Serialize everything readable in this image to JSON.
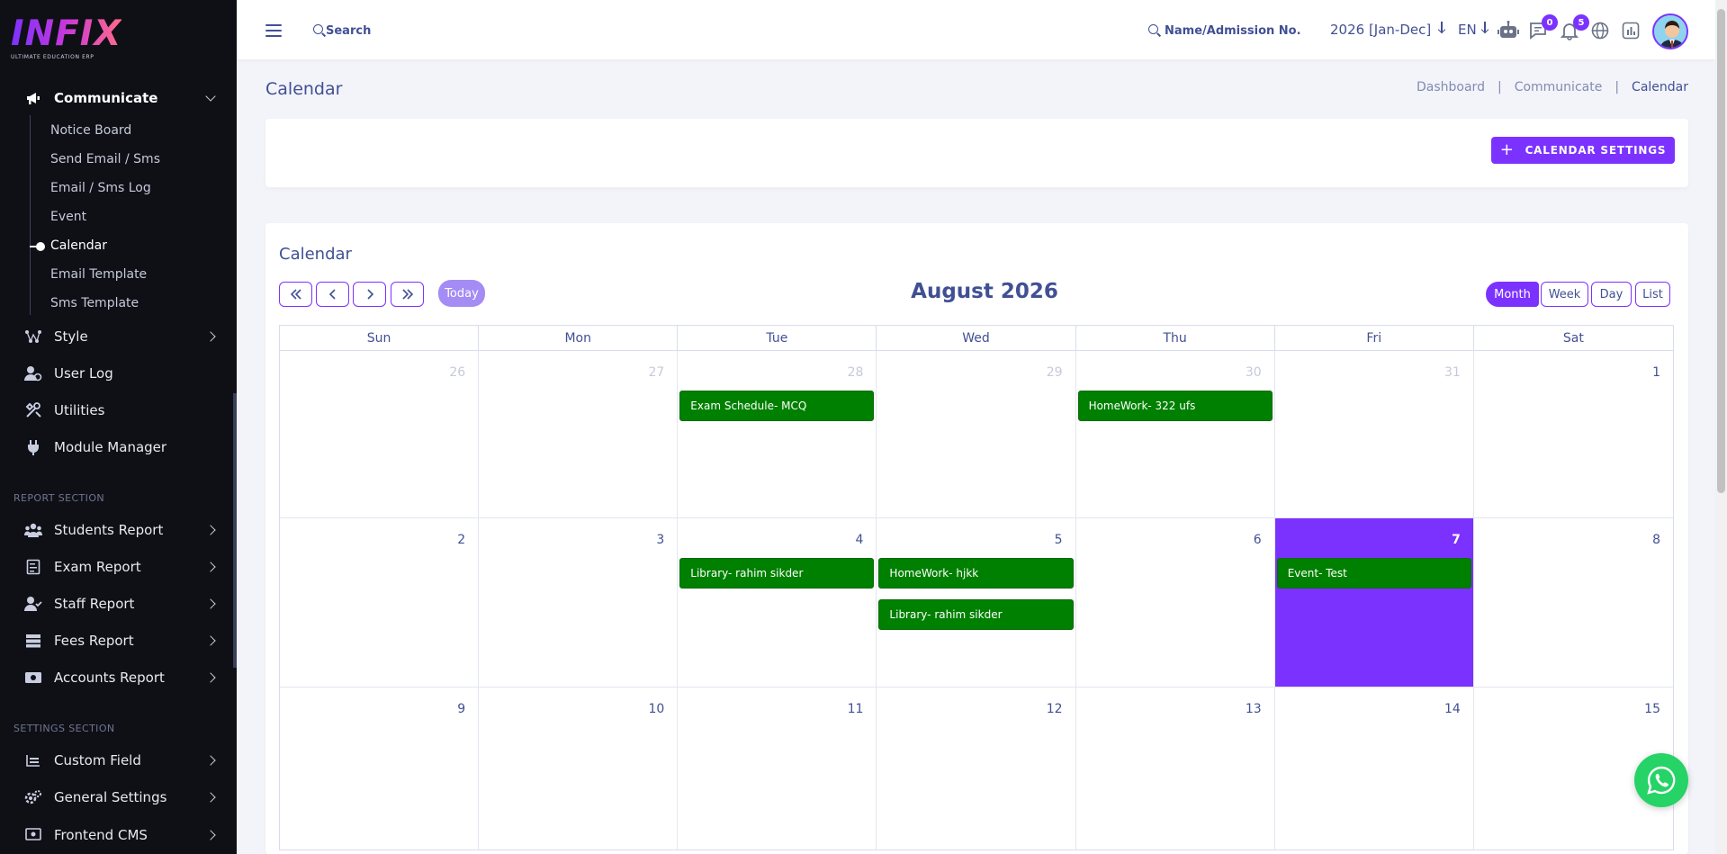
{
  "brand": {
    "logo_text": "INFIX",
    "tagline": "ULTIMATE EDUCATION ERP"
  },
  "sidebar": {
    "communicate": {
      "label": "Communicate",
      "icon": "megaphone-icon"
    },
    "sub_items": [
      {
        "label": "Notice Board"
      },
      {
        "label": "Send Email / Sms"
      },
      {
        "label": "Email / Sms Log"
      },
      {
        "label": "Event"
      },
      {
        "label": "Calendar"
      },
      {
        "label": "Email Template"
      },
      {
        "label": "Sms Template"
      }
    ],
    "items": [
      {
        "label": "Style",
        "icon": "style-icon"
      },
      {
        "label": "User Log",
        "icon": "user-log-icon"
      },
      {
        "label": "Utilities",
        "icon": "utilities-icon"
      },
      {
        "label": "Module Manager",
        "icon": "plug-icon"
      }
    ],
    "report_section": "REPORT SECTION",
    "report_items": [
      {
        "label": "Students Report",
        "icon": "students-icon"
      },
      {
        "label": "Exam Report",
        "icon": "exam-icon"
      },
      {
        "label": "Staff Report",
        "icon": "staff-icon"
      },
      {
        "label": "Fees Report",
        "icon": "fees-icon"
      },
      {
        "label": "Accounts Report",
        "icon": "accounts-icon"
      }
    ],
    "settings_section": "SETTINGS SECTION",
    "settings_items": [
      {
        "label": "Custom Field",
        "icon": "custom-field-icon"
      },
      {
        "label": "General Settings",
        "icon": "gear-icon"
      },
      {
        "label": "Frontend CMS",
        "icon": "cms-icon"
      }
    ]
  },
  "topbar": {
    "search_placeholder": "Search",
    "name_search_placeholder": "Name/Admission No.",
    "session": "2026 [Jan-Dec]",
    "language": "EN",
    "messages_count": "0",
    "notifications_count": "5"
  },
  "page": {
    "title": "Calendar",
    "breadcrumb": [
      "Dashboard",
      "Communicate",
      "Calendar"
    ],
    "settings_button": "CALENDAR SETTINGS"
  },
  "calendar": {
    "card_title": "Calendar",
    "month_label": "August 2026",
    "today_label": "Today",
    "views": [
      "Month",
      "Week",
      "Day",
      "List"
    ],
    "active_view": "Month",
    "weekdays": [
      "Sun",
      "Mon",
      "Tue",
      "Wed",
      "Thu",
      "Fri",
      "Sat"
    ],
    "weeks": [
      [
        {
          "day": "26",
          "other": true,
          "events": []
        },
        {
          "day": "27",
          "other": true,
          "events": []
        },
        {
          "day": "28",
          "other": true,
          "events": [
            "Exam Schedule- MCQ"
          ]
        },
        {
          "day": "29",
          "other": true,
          "events": []
        },
        {
          "day": "30",
          "other": true,
          "events": [
            "HomeWork- 322 ufs"
          ]
        },
        {
          "day": "31",
          "other": true,
          "events": []
        },
        {
          "day": "1",
          "other": false,
          "events": []
        }
      ],
      [
        {
          "day": "2",
          "other": false,
          "events": []
        },
        {
          "day": "3",
          "other": false,
          "events": []
        },
        {
          "day": "4",
          "other": false,
          "events": [
            "Library- rahim sikder"
          ]
        },
        {
          "day": "5",
          "other": false,
          "events": [
            "HomeWork- hjkk",
            "Library- rahim sikder"
          ]
        },
        {
          "day": "6",
          "other": false,
          "events": []
        },
        {
          "day": "7",
          "other": false,
          "today": true,
          "events": [
            "Event- Test"
          ]
        },
        {
          "day": "8",
          "other": false,
          "events": []
        }
      ],
      [
        {
          "day": "9",
          "other": false,
          "events": []
        },
        {
          "day": "10",
          "other": false,
          "events": []
        },
        {
          "day": "11",
          "other": false,
          "events": []
        },
        {
          "day": "12",
          "other": false,
          "events": []
        },
        {
          "day": "13",
          "other": false,
          "events": []
        },
        {
          "day": "14",
          "other": false,
          "events": []
        },
        {
          "day": "15",
          "other": false,
          "events": []
        }
      ]
    ]
  },
  "colors": {
    "accent": "#7c32ff",
    "event_green": "#008000",
    "text_primary": "#415094",
    "sidebar_bg": "#0e1016",
    "whatsapp": "#25d366"
  }
}
